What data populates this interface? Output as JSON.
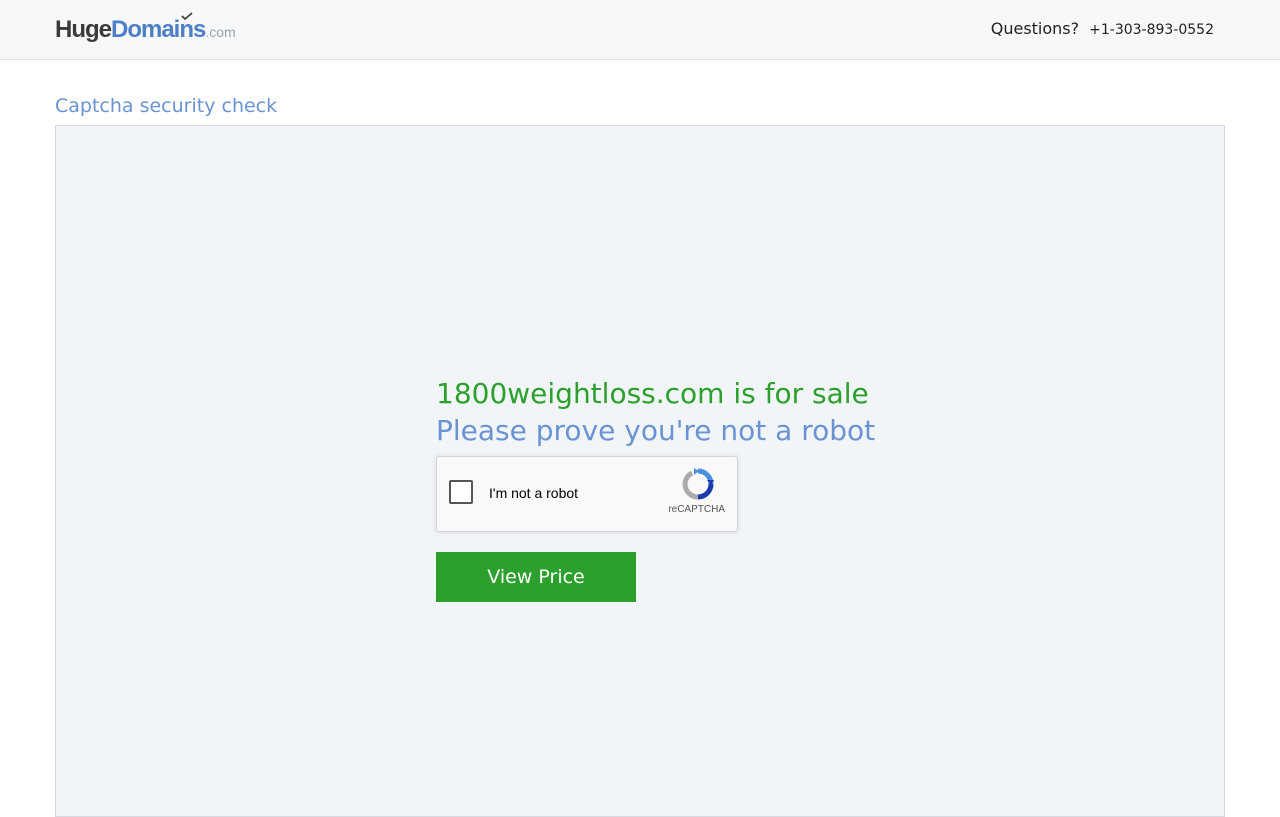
{
  "header": {
    "logo": {
      "part_huge": "Huge",
      "part_domains": "Domains",
      "part_com": ".com"
    },
    "questions_label": "Questions?",
    "phone": "+1-303-893-0552"
  },
  "main": {
    "section_title": "Captcha security check",
    "headline": "1800weightloss.com is for sale",
    "subline": "Please prove you're not a robot",
    "recaptcha": {
      "label": "I'm not a robot",
      "brand": "reCAPTCHA",
      "checked": false
    },
    "view_price_label": "View Price"
  },
  "colors": {
    "green": "#2ca02c",
    "blue": "#6a93d4",
    "logo_blue": "#4d7fc7",
    "panel_bg": "#f2f5f8"
  },
  "icons": [
    "logo-checkmark-icon",
    "recaptcha-logo-icon"
  ]
}
